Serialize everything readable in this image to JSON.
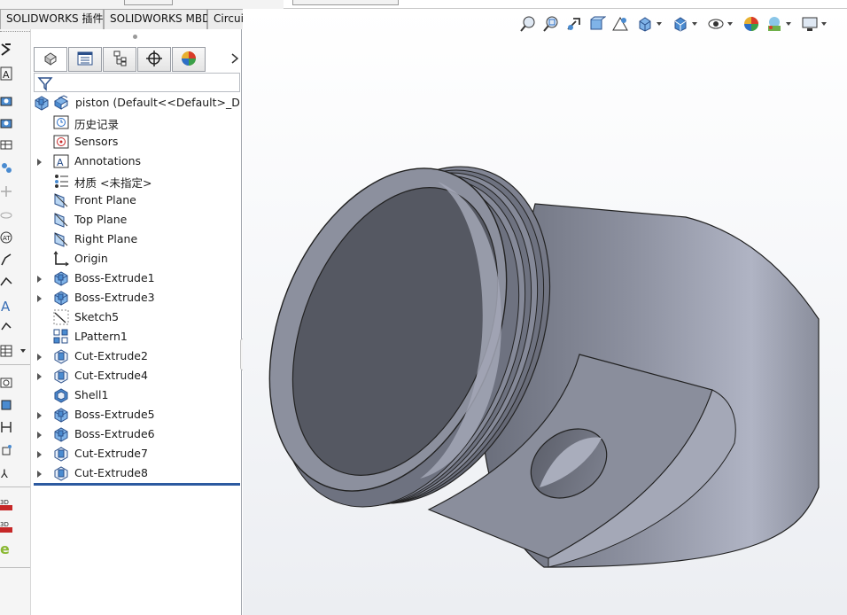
{
  "tabs": {
    "items": [
      {
        "label": "SOLIDWORKS 插件"
      },
      {
        "label": "SOLIDWORKS MBD"
      },
      {
        "label": "CircuitWorks"
      }
    ]
  },
  "feature_manager": {
    "panel_tabs": [
      {
        "icon": "feature-manager-icon",
        "active": true
      },
      {
        "icon": "property-manager-icon",
        "active": false
      },
      {
        "icon": "configuration-manager-icon",
        "active": false
      },
      {
        "icon": "dimxpert-manager-icon",
        "active": false
      },
      {
        "icon": "display-manager-icon",
        "active": false
      }
    ],
    "more_icon": "chevron-right-icon",
    "filter_icon": "filter-icon",
    "root": {
      "label": "piston  (Default<<Default>_Disp",
      "icon": "part-icon"
    },
    "items": [
      {
        "label": "历史记录",
        "icon": "history-icon",
        "expandable": false
      },
      {
        "label": "Sensors",
        "icon": "sensors-icon",
        "expandable": false
      },
      {
        "label": "Annotations",
        "icon": "annotations-icon",
        "expandable": true
      },
      {
        "label": "材质 <未指定>",
        "icon": "material-icon",
        "expandable": false
      },
      {
        "label": "Front Plane",
        "icon": "plane-icon",
        "expandable": false
      },
      {
        "label": "Top Plane",
        "icon": "plane-icon",
        "expandable": false
      },
      {
        "label": "Right Plane",
        "icon": "plane-icon",
        "expandable": false
      },
      {
        "label": "Origin",
        "icon": "origin-icon",
        "expandable": false
      },
      {
        "label": "Boss-Extrude1",
        "icon": "boss-extrude-icon",
        "expandable": true
      },
      {
        "label": "Boss-Extrude3",
        "icon": "boss-extrude-icon",
        "expandable": true
      },
      {
        "label": "Sketch5",
        "icon": "sketch-icon",
        "expandable": false
      },
      {
        "label": "LPattern1",
        "icon": "linear-pattern-icon",
        "expandable": false
      },
      {
        "label": "Cut-Extrude2",
        "icon": "cut-extrude-icon",
        "expandable": true
      },
      {
        "label": "Cut-Extrude4",
        "icon": "cut-extrude-icon",
        "expandable": true
      },
      {
        "label": "Shell1",
        "icon": "shell-icon",
        "expandable": false
      },
      {
        "label": "Boss-Extrude5",
        "icon": "boss-extrude-icon",
        "expandable": true
      },
      {
        "label": "Boss-Extrude6",
        "icon": "boss-extrude-icon",
        "expandable": true
      },
      {
        "label": "Cut-Extrude7",
        "icon": "cut-extrude-icon",
        "expandable": true
      },
      {
        "label": "Cut-Extrude8",
        "icon": "cut-extrude-icon",
        "expandable": true
      }
    ]
  },
  "heads_up_toolbar": [
    {
      "icon": "zoom-to-fit-icon"
    },
    {
      "icon": "zoom-to-area-icon"
    },
    {
      "icon": "previous-view-icon"
    },
    {
      "icon": "section-view-icon"
    },
    {
      "icon": "dynamic-annotation-views-icon"
    },
    {
      "icon": "view-orientation-icon",
      "dropdown": true
    },
    {
      "icon": "display-style-icon",
      "dropdown": true
    },
    {
      "icon": "hide-show-items-icon",
      "dropdown": true
    },
    {
      "icon": "edit-appearance-icon"
    },
    {
      "icon": "apply-scene-icon",
      "dropdown": true
    },
    {
      "icon": "view-settings-icon",
      "dropdown": true
    }
  ],
  "colors": {
    "part_face": "#8c909c",
    "part_dark": "#575a65",
    "part_light": "#b8bccb",
    "rollback_bar": "#2c5aa0",
    "accent": "#2c5aa0"
  }
}
